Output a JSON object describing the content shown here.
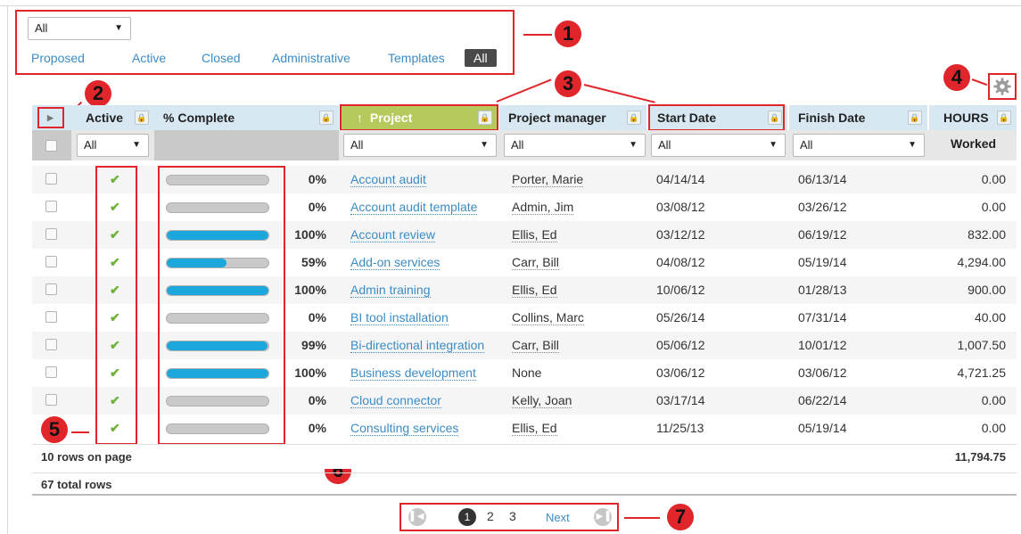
{
  "filter_bar": {
    "status_select": "All",
    "tabs": [
      "Proposed",
      "Active",
      "Closed",
      "Administrative",
      "Templates",
      "All"
    ],
    "active_tab": "All"
  },
  "callouts": [
    "1",
    "2",
    "3",
    "4",
    "5",
    "6",
    "7"
  ],
  "columns": {
    "active": "Active",
    "complete": "% Complete",
    "project": "Project",
    "project_sort_indicator": "↑",
    "manager": "Project manager",
    "start": "Start Date",
    "finish": "Finish Date",
    "hours": "HOURS",
    "hours_sub": "Worked"
  },
  "column_filters": {
    "active": "All",
    "project": "All",
    "manager": "All",
    "start": "All",
    "finish": "All"
  },
  "rows": [
    {
      "active": "✔",
      "pct_value": 0,
      "pct": "0%",
      "project": "Account audit",
      "manager": "Porter, Marie",
      "start": "04/14/14",
      "finish": "06/13/14",
      "hours": "0.00"
    },
    {
      "active": "✔",
      "pct_value": 0,
      "pct": "0%",
      "project": "Account audit template",
      "manager": "Admin, Jim",
      "start": "03/08/12",
      "finish": "03/26/12",
      "hours": "0.00"
    },
    {
      "active": "✔",
      "pct_value": 100,
      "pct": "100%",
      "project": "Account review",
      "manager": "Ellis, Ed",
      "start": "03/12/12",
      "finish": "06/19/12",
      "hours": "832.00"
    },
    {
      "active": "✔",
      "pct_value": 59,
      "pct": "59%",
      "project": "Add-on services",
      "manager": "Carr, Bill",
      "start": "04/08/12",
      "finish": "05/19/14",
      "hours": "4,294.00"
    },
    {
      "active": "✔",
      "pct_value": 100,
      "pct": "100%",
      "project": "Admin training",
      "manager": "Ellis, Ed",
      "start": "10/06/12",
      "finish": "01/28/13",
      "hours": "900.00"
    },
    {
      "active": "✔",
      "pct_value": 0,
      "pct": "0%",
      "project": "BI tool installation",
      "manager": "Collins, Marc",
      "start": "05/26/14",
      "finish": "07/31/14",
      "hours": "40.00"
    },
    {
      "active": "✔",
      "pct_value": 99,
      "pct": "99%",
      "project": "Bi-directional integration",
      "manager": "Carr, Bill",
      "start": "05/06/12",
      "finish": "10/01/12",
      "hours": "1,007.50"
    },
    {
      "active": "✔",
      "pct_value": 100,
      "pct": "100%",
      "project": "Business development",
      "manager": "None",
      "start": "03/06/12",
      "finish": "03/06/12",
      "hours": "4,721.25"
    },
    {
      "active": "✔",
      "pct_value": 0,
      "pct": "0%",
      "project": "Cloud connector",
      "manager": "Kelly, Joan",
      "start": "03/17/14",
      "finish": "06/22/14",
      "hours": "0.00"
    },
    {
      "active": "✔",
      "pct_value": 0,
      "pct": "0%",
      "project": "Consulting services",
      "manager": "Ellis, Ed",
      "start": "11/25/13",
      "finish": "05/19/14",
      "hours": "0.00"
    }
  ],
  "footer": {
    "rows_on_page": "10 rows on page",
    "total_rows": "67 total rows",
    "hours_total": "11,794.75"
  },
  "pagination": {
    "pages": [
      "1",
      "2",
      "3"
    ],
    "current": "1",
    "next": "Next"
  },
  "colors": {
    "accent_link": "#3b8cc5",
    "progress_fill": "#1ca8dd",
    "check_green": "#6fb23a",
    "callout_red": "#e0262b",
    "project_header": "#b5c95c"
  }
}
